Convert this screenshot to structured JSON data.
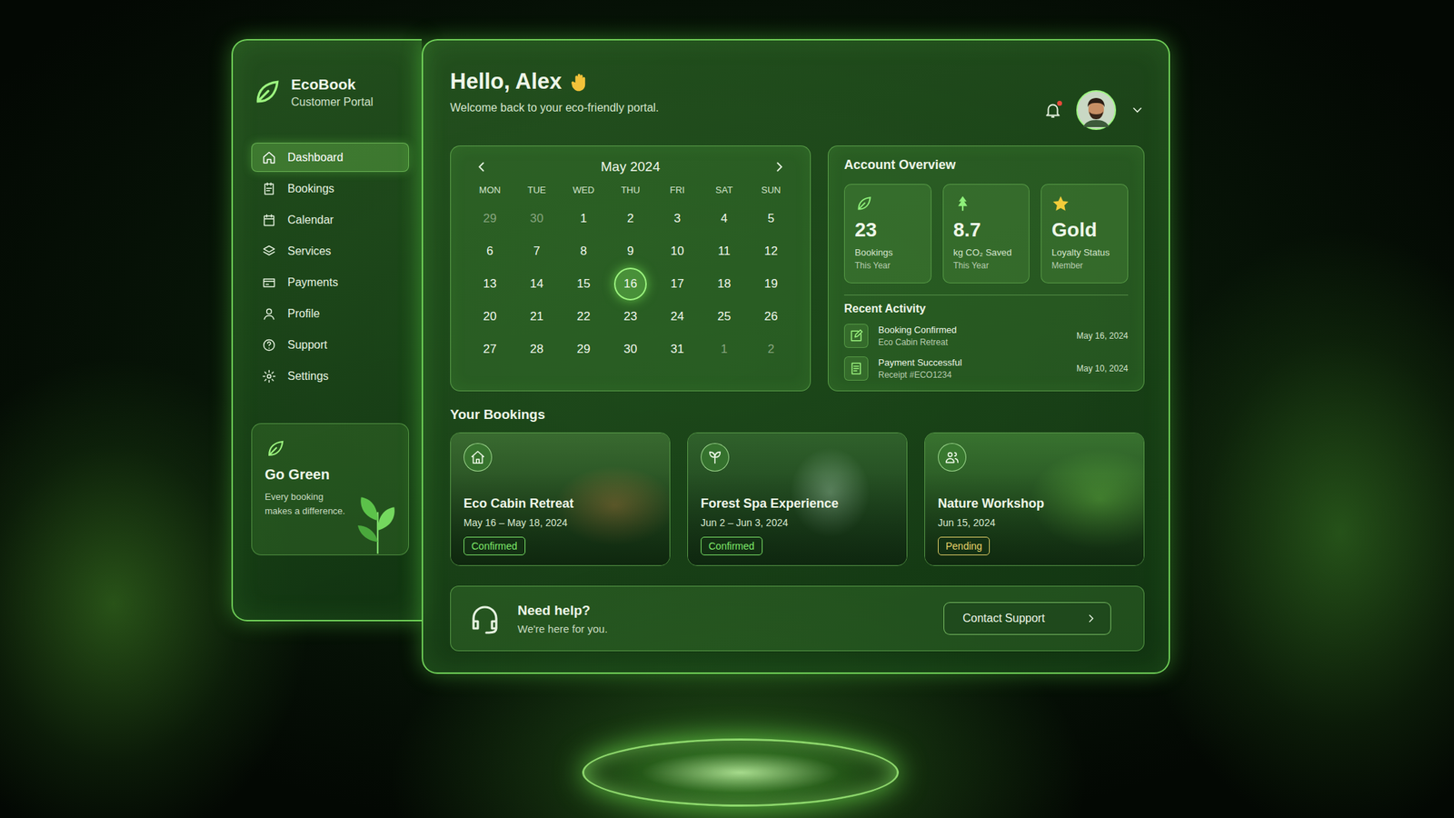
{
  "app": {
    "logo": {
      "name": "EcoBook",
      "subtitle": "Customer Portal"
    }
  },
  "sidebar": {
    "items": [
      {
        "label": "Dashboard",
        "selected": true
      },
      {
        "label": "Bookings",
        "selected": false
      },
      {
        "label": "Calendar",
        "selected": false
      },
      {
        "label": "Services",
        "selected": false
      },
      {
        "label": "Payments",
        "selected": false
      },
      {
        "label": "Profile",
        "selected": false
      },
      {
        "label": "Support",
        "selected": false
      },
      {
        "label": "Settings",
        "selected": false
      }
    ]
  },
  "promo": {
    "title": "Go Green",
    "text": "Every booking makes a difference."
  },
  "header": {
    "greeting": "Hello, Alex",
    "subtitle": "Welcome back to your eco-friendly portal.",
    "notifications": {
      "unread": true
    }
  },
  "calendar": {
    "month": "May 2024",
    "weekdays": [
      "MON",
      "TUE",
      "WED",
      "THU",
      "FRI",
      "SAT",
      "SUN"
    ],
    "weeks": [
      [
        {
          "day": "29",
          "muted": true,
          "selected": false
        },
        {
          "day": "30",
          "muted": true,
          "selected": false
        },
        {
          "day": "1",
          "muted": false,
          "selected": false
        },
        {
          "day": "2",
          "muted": false,
          "selected": false
        },
        {
          "day": "3",
          "muted": false,
          "selected": false
        },
        {
          "day": "4",
          "muted": false,
          "selected": false
        },
        {
          "day": "5",
          "muted": false,
          "selected": false
        }
      ],
      [
        {
          "day": "6",
          "muted": false,
          "selected": false
        },
        {
          "day": "7",
          "muted": false,
          "selected": false
        },
        {
          "day": "8",
          "muted": false,
          "selected": false
        },
        {
          "day": "9",
          "muted": false,
          "selected": false
        },
        {
          "day": "10",
          "muted": false,
          "selected": false
        },
        {
          "day": "11",
          "muted": false,
          "selected": false
        },
        {
          "day": "12",
          "muted": false,
          "selected": false
        }
      ],
      [
        {
          "day": "13",
          "muted": false,
          "selected": false
        },
        {
          "day": "14",
          "muted": false,
          "selected": false
        },
        {
          "day": "15",
          "muted": false,
          "selected": false
        },
        {
          "day": "16",
          "muted": false,
          "selected": true
        },
        {
          "day": "17",
          "muted": false,
          "selected": false
        },
        {
          "day": "18",
          "muted": false,
          "selected": false
        },
        {
          "day": "19",
          "muted": false,
          "selected": false
        }
      ],
      [
        {
          "day": "20",
          "muted": false,
          "selected": false
        },
        {
          "day": "21",
          "muted": false,
          "selected": false
        },
        {
          "day": "22",
          "muted": false,
          "selected": false
        },
        {
          "day": "23",
          "muted": false,
          "selected": false
        },
        {
          "day": "24",
          "muted": false,
          "selected": false
        },
        {
          "day": "25",
          "muted": false,
          "selected": false
        },
        {
          "day": "26",
          "muted": false,
          "selected": false
        }
      ],
      [
        {
          "day": "27",
          "muted": false,
          "selected": false
        },
        {
          "day": "28",
          "muted": false,
          "selected": false
        },
        {
          "day": "29",
          "muted": false,
          "selected": false
        },
        {
          "day": "30",
          "muted": false,
          "selected": false
        },
        {
          "day": "31",
          "muted": false,
          "selected": false
        },
        {
          "day": "1",
          "muted": true,
          "selected": false
        },
        {
          "day": "2",
          "muted": true,
          "selected": false
        }
      ]
    ]
  },
  "account_overview": {
    "title": "Account Overview",
    "stats": [
      {
        "value": "23",
        "label": "Bookings",
        "sublabel": "This Year"
      },
      {
        "value": "8.7",
        "label": "kg CO₂ Saved",
        "sublabel": "This Year"
      },
      {
        "value": "Gold",
        "label": "Loyalty Status",
        "sublabel": "Member"
      }
    ],
    "recent_activity": {
      "title": "Recent Activity",
      "items": [
        {
          "title": "Booking Confirmed",
          "detail": "Eco Cabin Retreat",
          "date": "May 16, 2024"
        },
        {
          "title": "Payment Successful",
          "detail": "Receipt #ECO1234",
          "date": "May 10, 2024"
        }
      ]
    }
  },
  "bookings": {
    "title": "Your Bookings",
    "items": [
      {
        "title": "Eco Cabin Retreat",
        "dates": "May 16 – May 18, 2024",
        "status": "Confirmed",
        "color": "#7ee86a"
      },
      {
        "title": "Forest Spa Experience",
        "dates": "Jun 2 – Jun 3, 2024",
        "status": "Confirmed",
        "color": "#7ee86a"
      },
      {
        "title": "Nature Workshop",
        "dates": "Jun 15, 2024",
        "status": "Pending",
        "color": "#e8d46a"
      }
    ]
  },
  "help": {
    "title": "Need help?",
    "text": "We're here for you.",
    "button": "Contact Support"
  }
}
